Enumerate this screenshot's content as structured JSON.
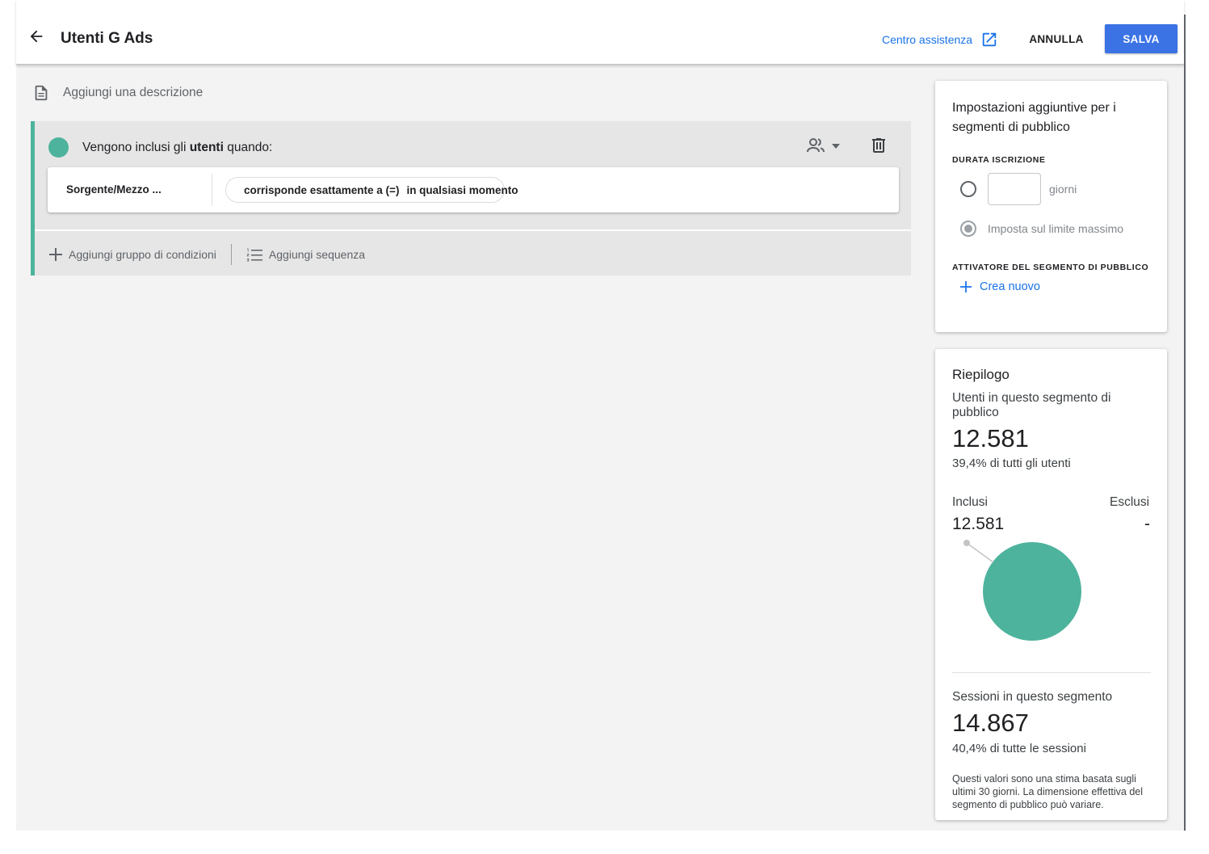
{
  "header": {
    "title": "Utenti G Ads",
    "help_label": "Centro assistenza",
    "cancel_label": "ANNULLA",
    "save_label": "SALVA"
  },
  "description": {
    "placeholder": "Aggiungi una descrizione"
  },
  "condition_group": {
    "heading_prefix": "Vengono inclusi gli ",
    "heading_bold": "utenti",
    "heading_suffix": " quando:",
    "accent_color": "#4db39c",
    "condition": {
      "dimension": "Sorgente/Mezzo ...",
      "operator": "corrisponde esattamente a (=)",
      "timing": "in qualsiasi momento"
    },
    "actions": {
      "add_group": "Aggiungi gruppo di condizioni",
      "add_sequence": "Aggiungi sequenza"
    }
  },
  "settings": {
    "title": "Impostazioni aggiuntive per i segmenti di pubblico",
    "duration_label": "DURATA ISCRIZIONE",
    "days_unit": "giorni",
    "days_value": "",
    "max_limit_label": "Imposta sul limite massimo",
    "trigger_label": "ATTIVATORE DEL SEGMENTO DI PUBBLICO",
    "create_new": "Crea nuovo"
  },
  "summary": {
    "title": "Riepilogo",
    "users_label": "Utenti in questo segmento di pubblico",
    "users_value": "12.581",
    "users_pct": "39,4% di tutti gli utenti",
    "included_label": "Inclusi",
    "excluded_label": "Esclusi",
    "included_value": "12.581",
    "excluded_value": "-",
    "sessions_label": "Sessioni in questo segmento",
    "sessions_value": "14.867",
    "sessions_pct": "40,4% di tutte le sessioni",
    "note": "Questi valori sono una stima basata sugli ultimi 30 giorni. La dimensione effettiva del segmento di pubblico può variare.",
    "pie_color": "#4db39c"
  },
  "chart_data": {
    "type": "pie",
    "categories": [
      "Inclusi",
      "Esclusi"
    ],
    "values": [
      12581,
      0
    ]
  },
  "colors": {
    "accent_blue": "#1a73e8",
    "primary_button": "#3b73e5"
  }
}
